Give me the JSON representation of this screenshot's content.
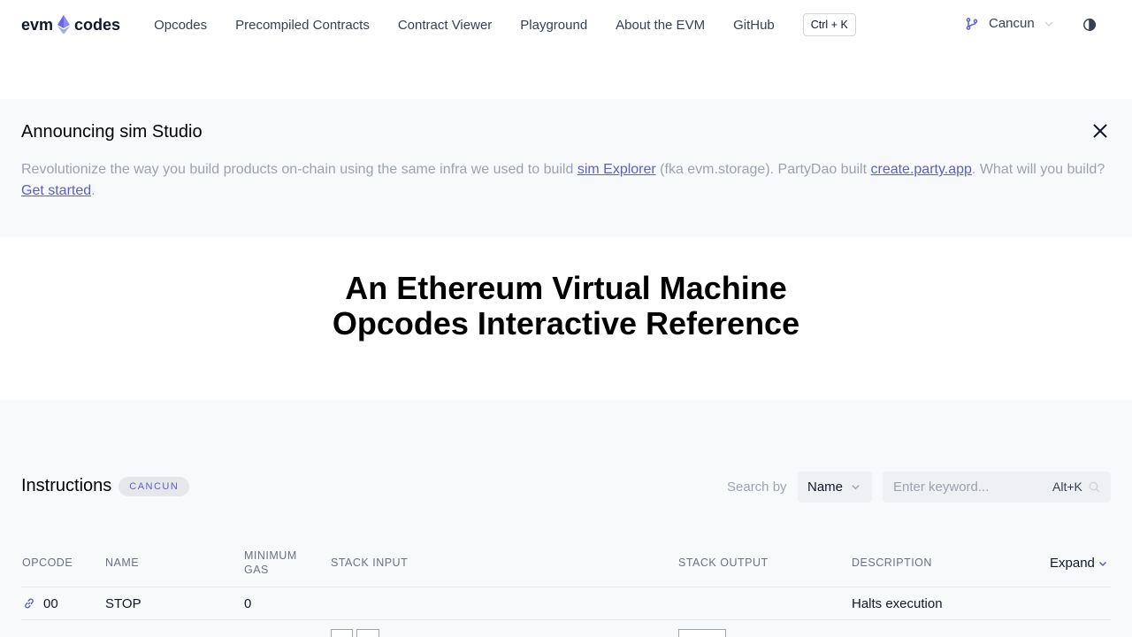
{
  "header": {
    "logo_left": "evm",
    "logo_right": "codes",
    "nav": [
      "Opcodes",
      "Precompiled Contracts",
      "Contract Viewer",
      "Playground",
      "About the EVM",
      "GitHub"
    ],
    "shortcut": "Ctrl + K",
    "fork": "Cancun",
    "accent": "#5b5fc7"
  },
  "announcement": {
    "title": "Announcing sim Studio",
    "text_1": "Revolutionize the way you build products on-chain using the same infra we used to build ",
    "link_1": "sim Explorer",
    "text_2": " (fka evm.storage). PartyDao built ",
    "link_2": "create.party.app",
    "text_3": ". What will you build? ",
    "link_3": "Get started",
    "text_4": "."
  },
  "hero": {
    "line1": "An Ethereum Virtual Machine",
    "line2": "Opcodes Interactive Reference"
  },
  "instructions": {
    "title": "Instructions",
    "badge": "CANCUN",
    "search_by_label": "Search by",
    "search_by_value": "Name",
    "search_placeholder": "Enter keyword...",
    "search_hint": "Alt+K",
    "columns": {
      "opcode": "OPCODE",
      "name": "NAME",
      "min_gas_1": "MINIMUM",
      "min_gas_2": "GAS",
      "stack_input": "STACK INPUT",
      "stack_output": "STACK OUTPUT",
      "description": "DESCRIPTION"
    },
    "expand_label": "Expand",
    "rows": [
      {
        "opcode": "00",
        "name": "STOP",
        "gas": "0",
        "description": "Halts execution"
      }
    ]
  }
}
